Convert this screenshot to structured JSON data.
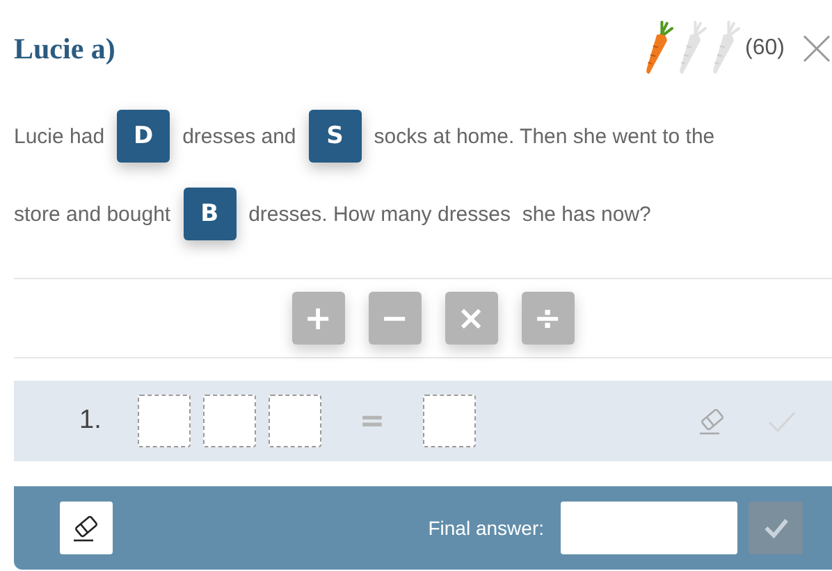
{
  "title": "Lucie a)",
  "carrots": [
    {
      "filled": true
    },
    {
      "filled": false
    },
    {
      "filled": false
    }
  ],
  "points": "(60)",
  "problem": {
    "lines": [
      [
        {
          "kind": "text",
          "text": "Lucie had"
        },
        {
          "kind": "tile",
          "text": "D"
        },
        {
          "kind": "text",
          "text": "dresses and"
        },
        {
          "kind": "tile",
          "text": "S"
        },
        {
          "kind": "text",
          "text": "socks at home. Then she went to the"
        }
      ],
      [
        {
          "kind": "text",
          "text": "store and bought"
        },
        {
          "kind": "tile",
          "text": "B"
        },
        {
          "kind": "text",
          "text": "dresses. How many dresses  she has now?"
        }
      ]
    ]
  },
  "operators": [
    {
      "symbol": "+"
    },
    {
      "symbol": "−"
    },
    {
      "symbol": "×"
    },
    {
      "symbol": "÷"
    }
  ],
  "equation_rows": [
    {
      "number": "1.",
      "slots": [
        {
          "kind": "box"
        },
        {
          "kind": "box"
        },
        {
          "kind": "box"
        },
        {
          "kind": "equals",
          "text": "="
        },
        {
          "kind": "box"
        }
      ],
      "check_disabled": true
    }
  ],
  "final_answer": {
    "label": "Final answer:",
    "submit_disabled": true
  }
}
